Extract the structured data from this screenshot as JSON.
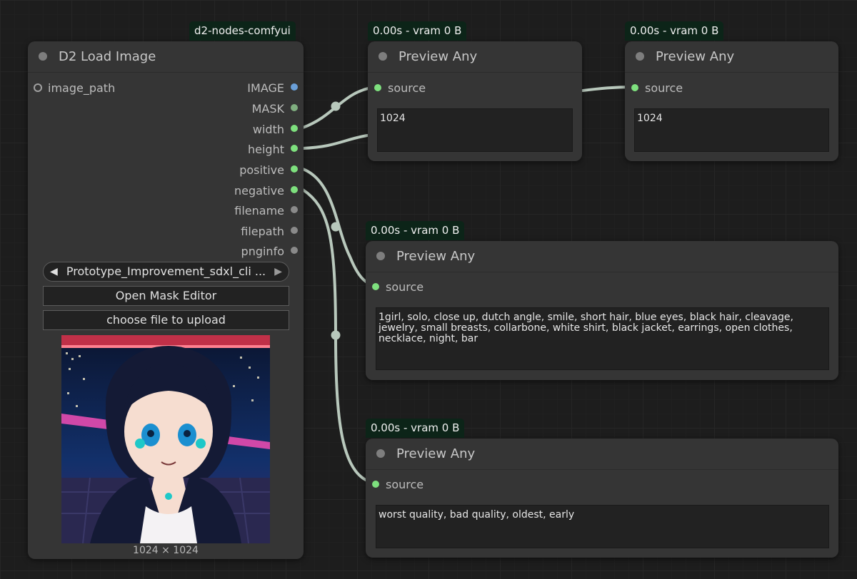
{
  "colors": {
    "background": "#1d1d1d",
    "node_bg": "#353535",
    "badge_bg": "#0c2418",
    "link": "#b8c8bc",
    "slot_green": "#7ee07e",
    "slot_blue": "#6a9fd8",
    "slot_gray": "#8a8a8a"
  },
  "load_node": {
    "badge": "d2-nodes-comfyui",
    "title": "D2 Load Image",
    "input": {
      "label": "image_path",
      "icon": "input-dot-icon"
    },
    "outputs": [
      {
        "label": "IMAGE"
      },
      {
        "label": "MASK"
      },
      {
        "label": "width"
      },
      {
        "label": "height"
      },
      {
        "label": "positive"
      },
      {
        "label": "negative"
      },
      {
        "label": "filename"
      },
      {
        "label": "filepath"
      },
      {
        "label": "pnginfo"
      }
    ],
    "combo_value": "Prototype_Improvement_sdxl_cli ...",
    "mask_button": "Open Mask Editor",
    "upload_button": "choose file to upload",
    "image_caption": "1024 × 1024"
  },
  "preview_nodes": [
    {
      "badge": "0.00s - vram 0 B",
      "title": "Preview Any",
      "input": "source",
      "value": "1024"
    },
    {
      "badge": "0.00s - vram 0 B",
      "title": "Preview Any",
      "input": "source",
      "value": "1024"
    },
    {
      "badge": "0.00s - vram 0 B",
      "title": "Preview Any",
      "input": "source",
      "value": "1girl, solo, close up, dutch angle, smile, short hair, blue eyes, black hair, cleavage, jewelry, small breasts, collarbone, white shirt, black jacket, earrings, open clothes, necklace, night, bar"
    },
    {
      "badge": "0.00s - vram 0 B",
      "title": "Preview Any",
      "input": "source",
      "value": "worst quality, bad quality, oldest, early"
    }
  ]
}
